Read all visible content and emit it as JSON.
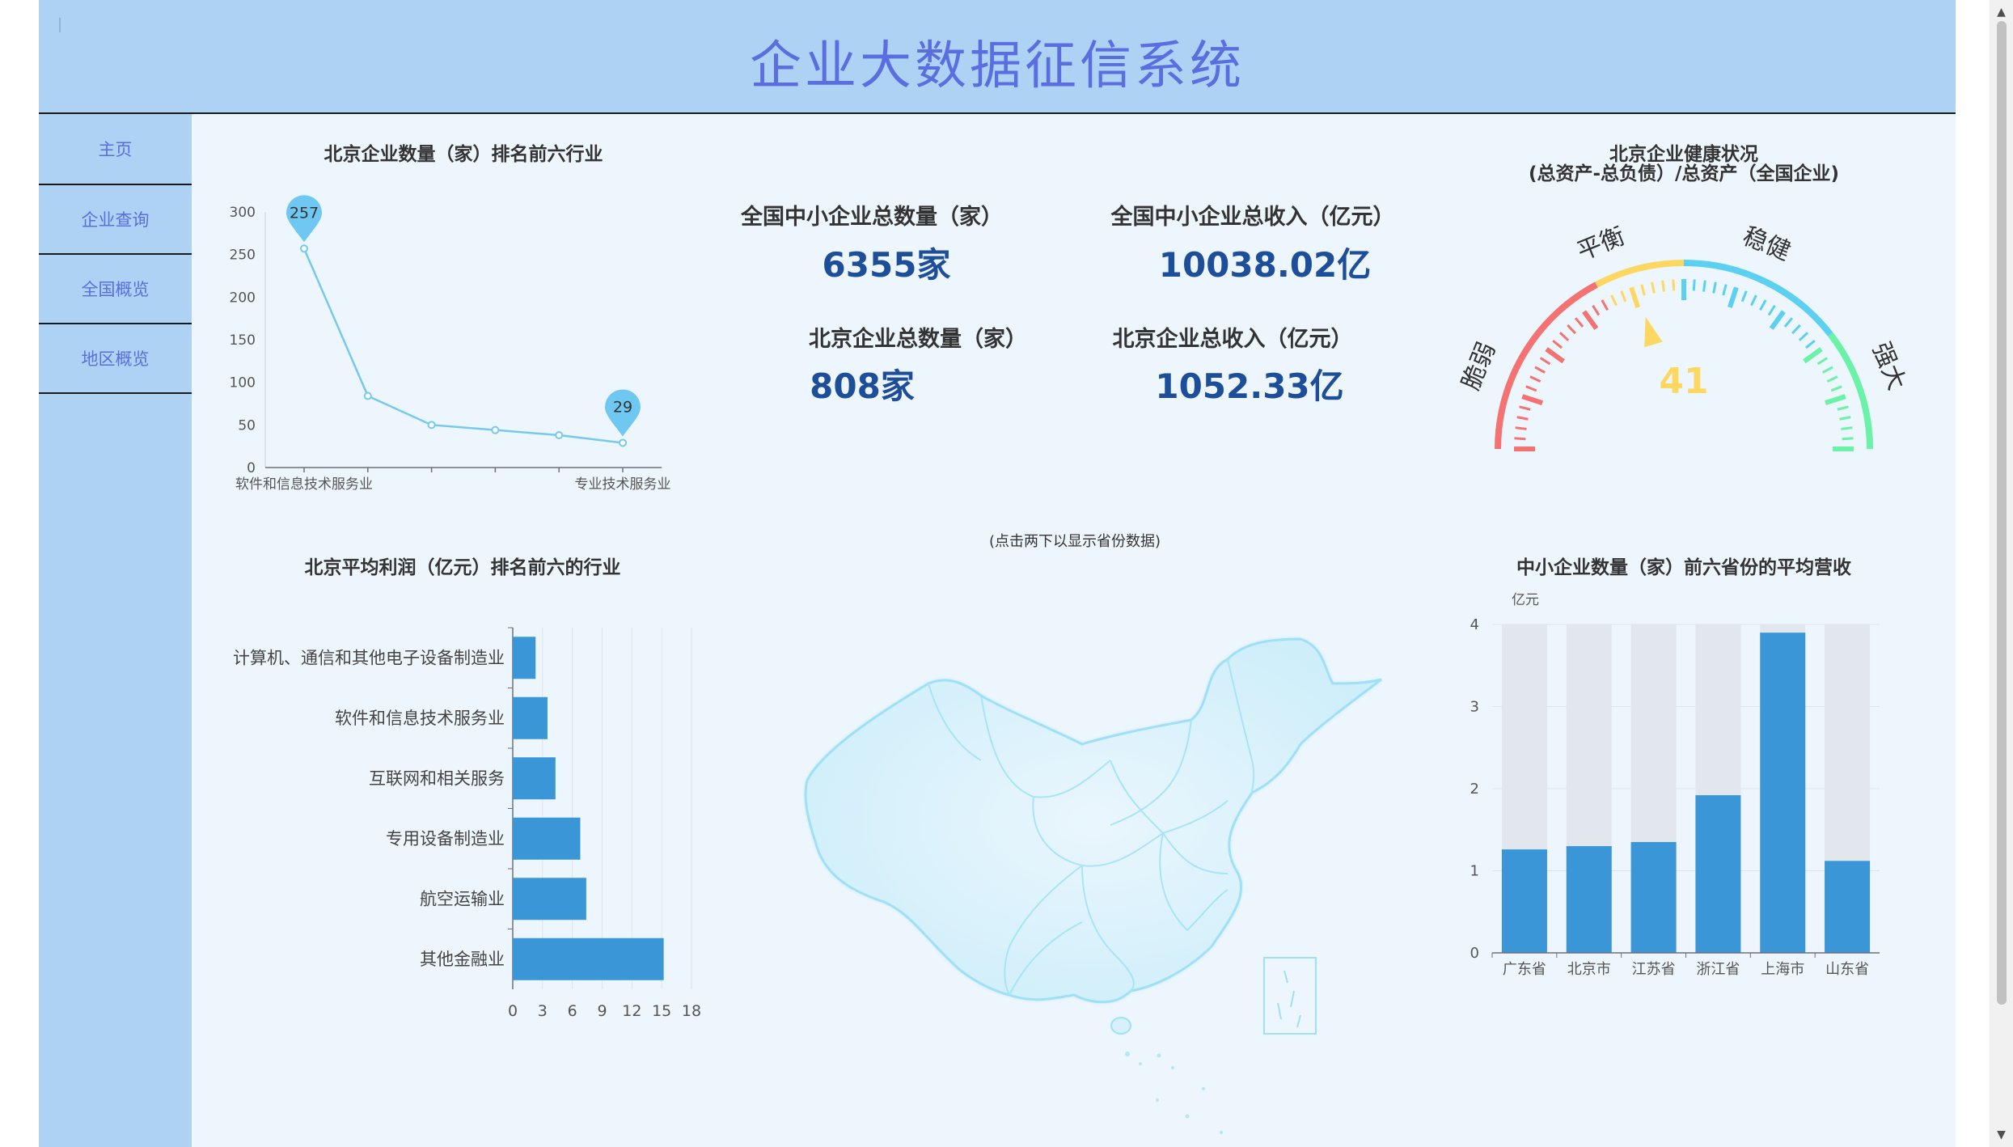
{
  "header": {
    "title": "企业大数据征信系统"
  },
  "nav": {
    "items": [
      "主页",
      "企业查询",
      "全国概览",
      "地区概览"
    ]
  },
  "stats": {
    "national_count": {
      "label": "全国中小企业总数量（家）",
      "value": "6355家"
    },
    "national_income": {
      "label": "全国中小企业总收入（亿元）",
      "value": "10038.02亿"
    },
    "beijing_count": {
      "label": "北京企业总数量（家）",
      "value": "808家"
    },
    "beijing_income": {
      "label": "北京企业总收入（亿元）",
      "value": "1052.33亿"
    }
  },
  "map": {
    "hint": "(点击两下以显示省份数据)"
  },
  "gauge": {
    "title": "北京企业健康状况",
    "subtitle": "(总资产-总负债）/总资产（全国企业)",
    "value": 41,
    "max": 100,
    "labels": [
      "脆弱",
      "平衡",
      "稳健",
      "强大"
    ],
    "colors": [
      "#f47272",
      "#fcd863",
      "#5cd0f0",
      "#6af2a8"
    ]
  },
  "colors": {
    "accent": "#5b6ee0",
    "bar": "#3a96d6",
    "line": "#76c9ee",
    "stat_value": "#1d4e9a"
  },
  "chart_data": [
    {
      "type": "line",
      "title": "北京企业数量（家）排名前六行业",
      "categories": [
        "软件和信息技术服务业",
        "",
        "",
        "",
        "",
        "专业技术服务业"
      ],
      "values": [
        257,
        84,
        50,
        44,
        38,
        29
      ],
      "ylim": [
        0,
        300
      ],
      "yticks": [
        "0",
        "50",
        "100",
        "150",
        "200",
        "250",
        "300"
      ],
      "markers": [
        {
          "index": 0,
          "label": "257"
        },
        {
          "index": 5,
          "label": "29"
        }
      ]
    },
    {
      "type": "bar",
      "orientation": "horizontal",
      "title": "北京平均利润（亿元）排名前六的行业",
      "categories": [
        "计算机、通信和其他电子设备制造业",
        "软件和信息技术服务业",
        "互联网和相关服务",
        "专用设备制造业",
        "航空运输业",
        "其他金融业"
      ],
      "values": [
        2.3,
        3.5,
        4.3,
        6.8,
        7.4,
        15.2
      ],
      "xlim": [
        0,
        18
      ],
      "xticks": [
        "0",
        "3",
        "6",
        "9",
        "12",
        "15",
        "18"
      ]
    },
    {
      "type": "bar",
      "title": "中小企业数量（家）前六省份的平均营收",
      "ylabel": "亿元",
      "categories": [
        "广东省",
        "北京市",
        "江苏省",
        "浙江省",
        "上海市",
        "山东省"
      ],
      "values": [
        1.26,
        1.3,
        1.35,
        1.92,
        3.9,
        1.12
      ],
      "ylim": [
        0,
        4
      ],
      "yticks": [
        "0",
        "1",
        "2",
        "3",
        "4"
      ],
      "background_bars": true
    }
  ]
}
